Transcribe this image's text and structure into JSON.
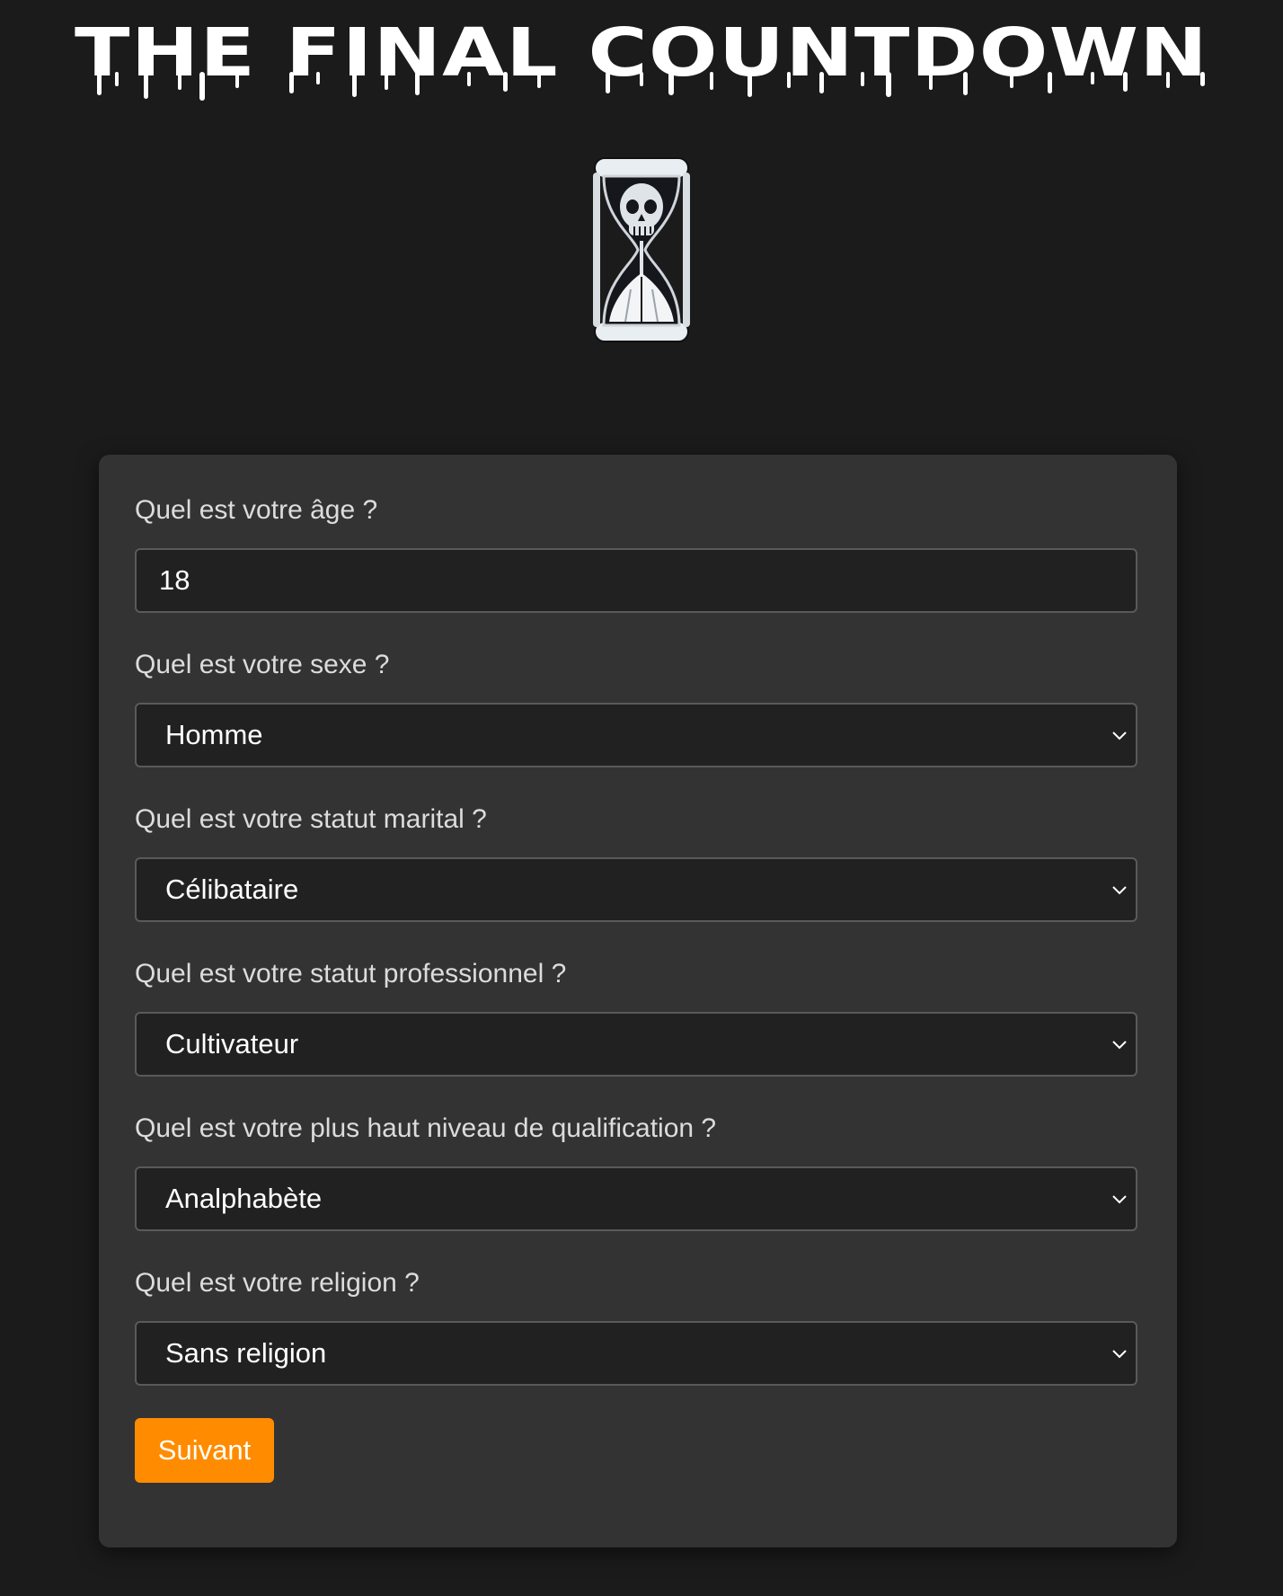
{
  "header": {
    "title": "THE FINAL COUNTDOWN",
    "logo_icon": "skull-hourglass-icon"
  },
  "form": {
    "fields": [
      {
        "label": "Quel est votre âge ?",
        "value": "18",
        "kind": "input"
      },
      {
        "label": "Quel est votre sexe ?",
        "value": "Homme",
        "kind": "select"
      },
      {
        "label": "Quel est votre statut marital ?",
        "value": "Célibataire",
        "kind": "select"
      },
      {
        "label": "Quel est votre statut professionnel ?",
        "value": "Cultivateur",
        "kind": "select"
      },
      {
        "label": "Quel est votre plus haut niveau de qualification ?",
        "value": "Analphabète",
        "kind": "select"
      },
      {
        "label": "Quel est votre religion ?",
        "value": "Sans religion",
        "kind": "select"
      }
    ],
    "submit_label": "Suivant"
  },
  "colors": {
    "background": "#1b1b1b",
    "card": "#333333",
    "field": "#212121",
    "accent": "#ff8c00"
  }
}
